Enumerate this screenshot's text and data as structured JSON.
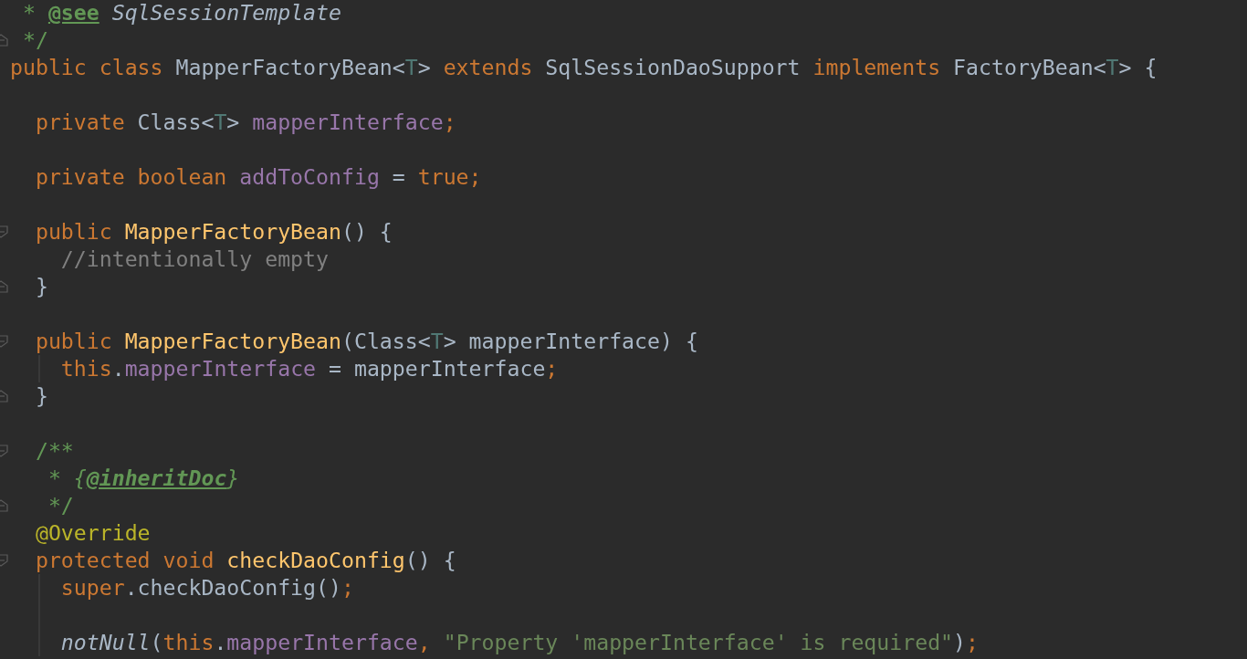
{
  "editor": {
    "lines": [
      {
        "kind": "code",
        "tokens": [
          {
            "kind": "doc",
            "text": " * "
          },
          {
            "kind": "doctag",
            "text": "@see"
          },
          {
            "kind": "docref",
            "text": " SqlSessionTemplate"
          }
        ]
      },
      {
        "kind": "code",
        "fold_end": true,
        "tokens": [
          {
            "kind": "doc",
            "text": " */"
          }
        ]
      },
      {
        "kind": "code",
        "tokens": [
          {
            "kind": "kw",
            "text": "public class "
          },
          {
            "kind": "plain",
            "text": "MapperFactoryBean<"
          },
          {
            "kind": "tparam",
            "text": "T"
          },
          {
            "kind": "plain",
            "text": "> "
          },
          {
            "kind": "kw",
            "text": "extends "
          },
          {
            "kind": "plain",
            "text": "SqlSessionDaoSupport "
          },
          {
            "kind": "kw",
            "text": "implements "
          },
          {
            "kind": "plain",
            "text": "FactoryBean<"
          },
          {
            "kind": "tparam",
            "text": "T"
          },
          {
            "kind": "plain",
            "text": "> {"
          }
        ]
      },
      {
        "kind": "blank"
      },
      {
        "kind": "code",
        "tokens": [
          {
            "kind": "kw",
            "text": "  private "
          },
          {
            "kind": "plain",
            "text": "Class<"
          },
          {
            "kind": "tparam",
            "text": "T"
          },
          {
            "kind": "plain",
            "text": "> "
          },
          {
            "kind": "field",
            "text": "mapperInterface"
          },
          {
            "kind": "kw",
            "text": ";"
          }
        ]
      },
      {
        "kind": "blank"
      },
      {
        "kind": "code",
        "tokens": [
          {
            "kind": "kw",
            "text": "  private boolean "
          },
          {
            "kind": "field",
            "text": "addToConfig"
          },
          {
            "kind": "plain",
            "text": " = "
          },
          {
            "kind": "kw",
            "text": "true;"
          }
        ]
      },
      {
        "kind": "blank"
      },
      {
        "kind": "code",
        "fold_start": true,
        "tokens": [
          {
            "kind": "kw",
            "text": "  public "
          },
          {
            "kind": "method",
            "text": "MapperFactoryBean"
          },
          {
            "kind": "plain",
            "text": "() {"
          }
        ]
      },
      {
        "kind": "code",
        "tokens": [
          {
            "kind": "comment",
            "text": "    //intentionally empty"
          }
        ]
      },
      {
        "kind": "code",
        "fold_end": true,
        "tokens": [
          {
            "kind": "plain",
            "text": "  }"
          }
        ]
      },
      {
        "kind": "blank"
      },
      {
        "kind": "code",
        "fold_start": true,
        "tokens": [
          {
            "kind": "kw",
            "text": "  public "
          },
          {
            "kind": "method",
            "text": "MapperFactoryBean"
          },
          {
            "kind": "plain",
            "text": "(Class<"
          },
          {
            "kind": "tparam",
            "text": "T"
          },
          {
            "kind": "plain",
            "text": "> mapperInterface) {"
          }
        ]
      },
      {
        "kind": "code",
        "guide": true,
        "tokens": [
          {
            "kind": "kw",
            "text": "    this"
          },
          {
            "kind": "plain",
            "text": "."
          },
          {
            "kind": "field",
            "text": "mapperInterface"
          },
          {
            "kind": "plain",
            "text": " = mapperInterface"
          },
          {
            "kind": "kw",
            "text": ";"
          }
        ]
      },
      {
        "kind": "code",
        "fold_end": true,
        "tokens": [
          {
            "kind": "plain",
            "text": "  }"
          }
        ]
      },
      {
        "kind": "blank"
      },
      {
        "kind": "code",
        "fold_start": true,
        "tokens": [
          {
            "kind": "doc",
            "text": "  /**"
          }
        ]
      },
      {
        "kind": "code",
        "tokens": [
          {
            "kind": "doc",
            "text": "   * "
          },
          {
            "kind": "docitalic",
            "text": "{"
          },
          {
            "kind": "doctagitalic",
            "text": "@inheritDoc"
          },
          {
            "kind": "docitalic",
            "text": "}"
          }
        ]
      },
      {
        "kind": "code",
        "fold_end": true,
        "tokens": [
          {
            "kind": "doc",
            "text": "   */"
          }
        ]
      },
      {
        "kind": "code",
        "tokens": [
          {
            "kind": "annotation",
            "text": "  @Override"
          }
        ]
      },
      {
        "kind": "code",
        "fold_start": true,
        "tokens": [
          {
            "kind": "kw",
            "text": "  protected void "
          },
          {
            "kind": "method",
            "text": "checkDaoConfig"
          },
          {
            "kind": "plain",
            "text": "() {"
          }
        ]
      },
      {
        "kind": "code",
        "guide": true,
        "tokens": [
          {
            "kind": "kw",
            "text": "    super"
          },
          {
            "kind": "plain",
            "text": ".checkDaoConfig()"
          },
          {
            "kind": "kw",
            "text": ";"
          }
        ]
      },
      {
        "kind": "blank",
        "guide": true
      },
      {
        "kind": "code",
        "guide": true,
        "tokens": [
          {
            "kind": "staticcall",
            "text": "    notNull"
          },
          {
            "kind": "plain",
            "text": "("
          },
          {
            "kind": "kw",
            "text": "this"
          },
          {
            "kind": "plain",
            "text": "."
          },
          {
            "kind": "field",
            "text": "mapperInterface"
          },
          {
            "kind": "kw",
            "text": ", "
          },
          {
            "kind": "string",
            "text": "\"Property 'mapperInterface' is required\""
          },
          {
            "kind": "plain",
            "text": ")"
          },
          {
            "kind": "kw",
            "text": ";"
          }
        ]
      }
    ]
  }
}
